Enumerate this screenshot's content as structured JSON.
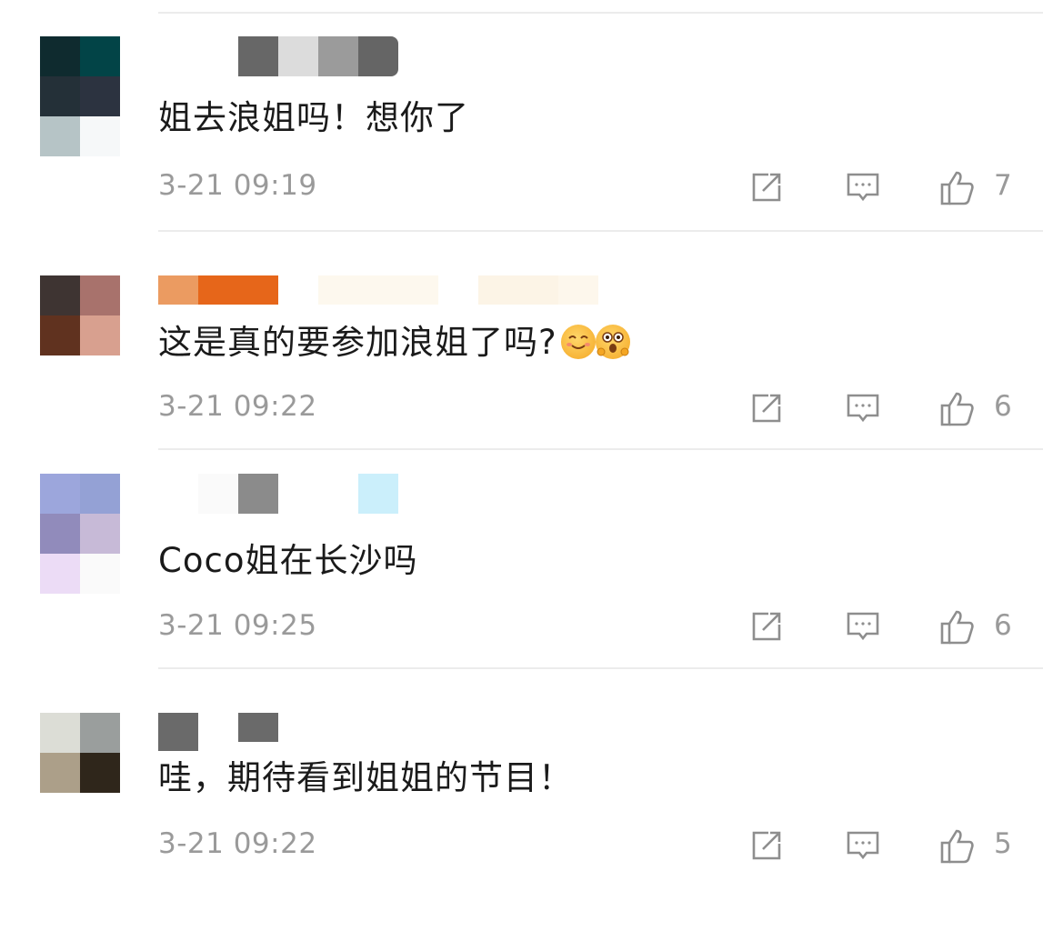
{
  "comments": [
    {
      "text": "姐去浪姐吗！想你了",
      "time": "3-21 09:19",
      "likes": "7",
      "avatar_colors": [
        "#0f2b2f",
        "#024447",
        "#243038",
        "#2c3340",
        "#b6c4c6",
        "#f6f8f9"
      ],
      "name_blocks": [
        {
          "color": "#676767"
        },
        {
          "color": "#dcdcdc"
        },
        {
          "color": "#9b9b9b"
        },
        {
          "color": "#656565"
        }
      ],
      "emojis": []
    },
    {
      "text": "这是真的要参加浪姐了吗?",
      "time": "3-21 09:22",
      "likes": "6",
      "avatar_colors": [
        "#3e3432",
        "#a8726c",
        "#60321f",
        "#d8a08f",
        "#ffffff",
        "#ffffff"
      ],
      "name_blocks": [
        {
          "color": "#eb9b61"
        },
        {
          "color": "#e6661a"
        },
        {
          "color": "#fdf8ee"
        },
        {
          "color": "#fcf4e6"
        },
        {
          "color": "#fdf7ec"
        }
      ],
      "emojis": [
        "smile-emoji-icon",
        "excited-emoji-icon"
      ]
    },
    {
      "text": "Coco姐在长沙吗",
      "time": "3-21 09:25",
      "likes": "6",
      "avatar_colors": [
        "#9ca6dc",
        "#94a1d5",
        "#918bbb",
        "#c7bad7",
        "#ecdcf6",
        "#fafafa"
      ],
      "name_blocks": [
        {
          "color": "#fafafa"
        },
        {
          "color": "#8b8b8b"
        },
        {
          "color": "#cbeffb"
        }
      ],
      "emojis": []
    },
    {
      "text": "哇，期待看到姐姐的节目！",
      "time": "3-21 09:22",
      "likes": "5",
      "avatar_colors": [
        "#dcddd6",
        "#9a9e9d",
        "#ac9f89",
        "#2f261b",
        "#ffffff",
        "#ffffff"
      ],
      "name_blocks": [
        {
          "color": "#6a6a6a"
        },
        {
          "color": "#6a6a6a"
        }
      ],
      "emojis": []
    }
  ],
  "icons": {
    "share": "share-icon",
    "reply": "reply-icon",
    "like": "thumbs-up-icon"
  },
  "colors": {
    "text": "#1a1a1a",
    "meta": "#9a9a9a",
    "divider": "#ececec"
  }
}
